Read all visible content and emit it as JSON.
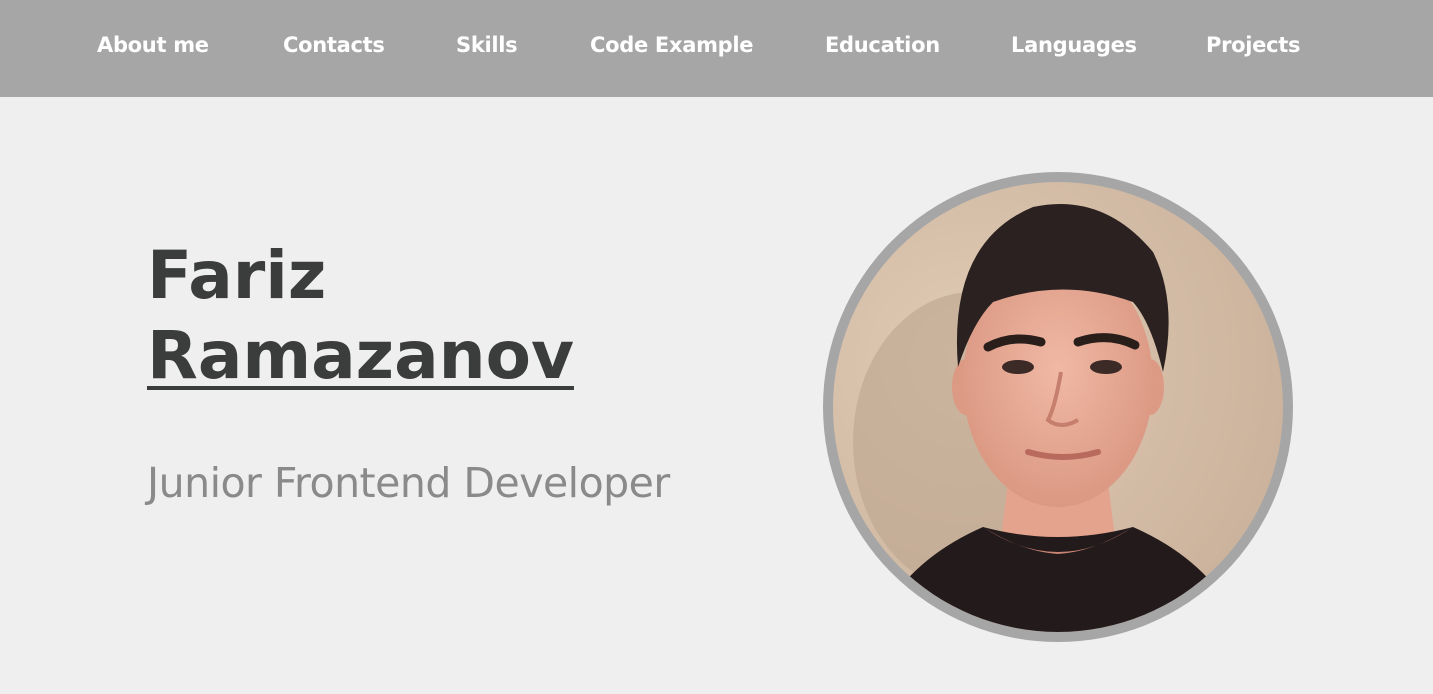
{
  "nav": {
    "items": [
      {
        "label": "About me"
      },
      {
        "label": "Contacts"
      },
      {
        "label": "Skills"
      },
      {
        "label": "Code Example"
      },
      {
        "label": "Education"
      },
      {
        "label": "Languages"
      },
      {
        "label": "Projects"
      }
    ]
  },
  "hero": {
    "first_name": "Fariz",
    "last_name": "Ramazanov",
    "role": "Junior Frontend Developer"
  },
  "colors": {
    "nav_background": "#a6a6a6",
    "page_background": "#efefef",
    "name_text": "#3a3d3c",
    "role_text": "#8a8a8a"
  },
  "icons": {
    "avatar": "profile-photo"
  }
}
